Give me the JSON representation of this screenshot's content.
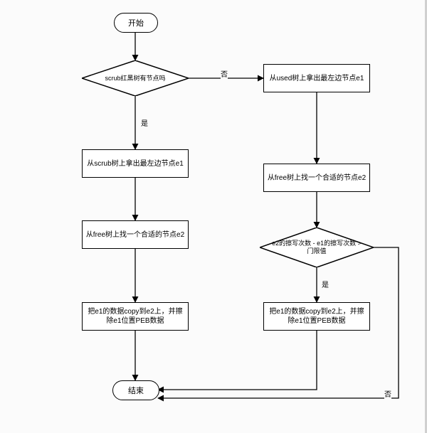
{
  "chart_data": {
    "type": "flowchart",
    "nodes": [
      {
        "id": "start",
        "kind": "terminator",
        "text": "开始"
      },
      {
        "id": "d1",
        "kind": "decision",
        "text": "scrub红黑树有节点吗"
      },
      {
        "id": "pL1",
        "kind": "process",
        "text": "从scrub树上拿出最左边节点e1"
      },
      {
        "id": "pL2",
        "kind": "process",
        "text": "从free树上找一个合适的节点e2"
      },
      {
        "id": "pL3",
        "kind": "process",
        "text": "把e1的数据copy到e2上，并擦除e1位置PEB数据"
      },
      {
        "id": "pR1",
        "kind": "process",
        "text": "从used树上拿出最左边节点e1"
      },
      {
        "id": "pR2",
        "kind": "process",
        "text": "从free树上找一个合适的节点e2"
      },
      {
        "id": "d2",
        "kind": "decision",
        "text": "e2的擦写次数 - e1的擦写次数 > 门限值"
      },
      {
        "id": "pR3",
        "kind": "process",
        "text": "把e1的数据copy到e2上，并擦除e1位置PEB数据"
      },
      {
        "id": "end",
        "kind": "terminator",
        "text": "结束"
      }
    ],
    "edges": [
      {
        "from": "start",
        "to": "d1"
      },
      {
        "from": "d1",
        "to": "pL1",
        "label": "是"
      },
      {
        "from": "d1",
        "to": "pR1",
        "label": "否"
      },
      {
        "from": "pL1",
        "to": "pL2"
      },
      {
        "from": "pL2",
        "to": "pL3"
      },
      {
        "from": "pL3",
        "to": "end"
      },
      {
        "from": "pR1",
        "to": "pR2"
      },
      {
        "from": "pR2",
        "to": "d2"
      },
      {
        "from": "d2",
        "to": "pR3",
        "label": "是"
      },
      {
        "from": "d2",
        "to": "end",
        "label": "否"
      },
      {
        "from": "pR3",
        "to": "end"
      }
    ]
  },
  "nodes": {
    "start": "开始",
    "d1": "scrub红黑树有节点吗",
    "pL1": "从scrub树上拿出最左边节点e1",
    "pL2": "从free树上找一个合适的节点e2",
    "pL3": "把e1的数据copy到e2上，并擦除e1位置PEB数据",
    "pR1": "从used树上拿出最左边节点e1",
    "pR2": "从free树上找一个合适的节点e2",
    "d2": "e2的擦写次数 - e1的擦写次数 > 门限值",
    "pR3": "把e1的数据copy到e2上，并擦除e1位置PEB数据",
    "end": "结束"
  },
  "labels": {
    "yes": "是",
    "no": "否"
  }
}
